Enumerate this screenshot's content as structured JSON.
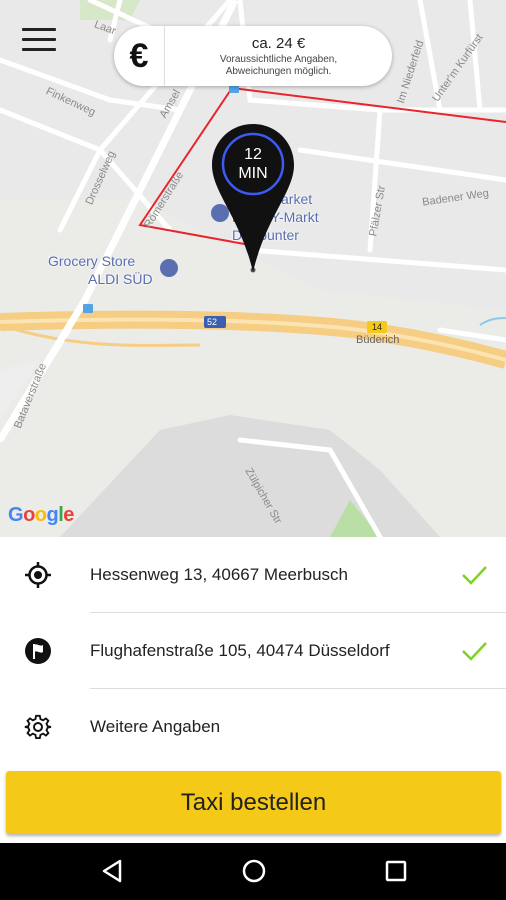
{
  "menu": {
    "icon": "hamburger-menu-icon"
  },
  "price": {
    "currency_symbol": "€",
    "estimate": "ca. 24 €",
    "note_line1": "Voraussichtliche Angaben,",
    "note_line2": "Abweichungen möglich."
  },
  "map": {
    "streets": {
      "finkenweg": "Finkenweg",
      "drosselweg": "Drosselweg",
      "amsel": "Amsel",
      "laar": "Laar",
      "roemerstrasse": "Römerstraße",
      "im_niederfeld": "Im Niederfeld",
      "unter_kurfuerst": "Unter'm Kurfürst",
      "pfaelzer": "Pfälzer Str",
      "badener": "Badener Weg",
      "bataverstrasse": "Bataverstraße",
      "zuelpicher": "Zülpicher Str",
      "highway_52": "52",
      "highway_14": "14",
      "buederich": "Büderich"
    },
    "poi_grocery": {
      "line1": "Grocery Store",
      "line2": "ALDI SÜD"
    },
    "poi_supermarket": {
      "line1": "Supermarket",
      "line2": "PENNY-Markt",
      "line3": "Discounter"
    },
    "pin": {
      "number": "12",
      "unit": "MIN"
    },
    "attribution": "Google",
    "colors": {
      "route": "#e8252b",
      "pin": "#111111",
      "pin_ring": "#3d5af1"
    }
  },
  "addresses": {
    "pickup": {
      "text": "Hessenweg 13, 40667 Meerbusch",
      "icon": "location-target-icon",
      "status_icon": "checkmark-icon"
    },
    "destination": {
      "text": "Flughafenstraße 105, 40474 Düsseldorf",
      "icon": "flag-icon",
      "status_icon": "checkmark-icon"
    },
    "more": {
      "text": "Weitere Angaben",
      "icon": "gear-icon"
    }
  },
  "order_button": {
    "label": "Taxi bestellen",
    "color": "#f5c918"
  },
  "check_color": "#7ed321",
  "navigation_bar": {
    "back": "back-triangle-icon",
    "home": "home-circle-icon",
    "recents": "recents-square-icon"
  }
}
